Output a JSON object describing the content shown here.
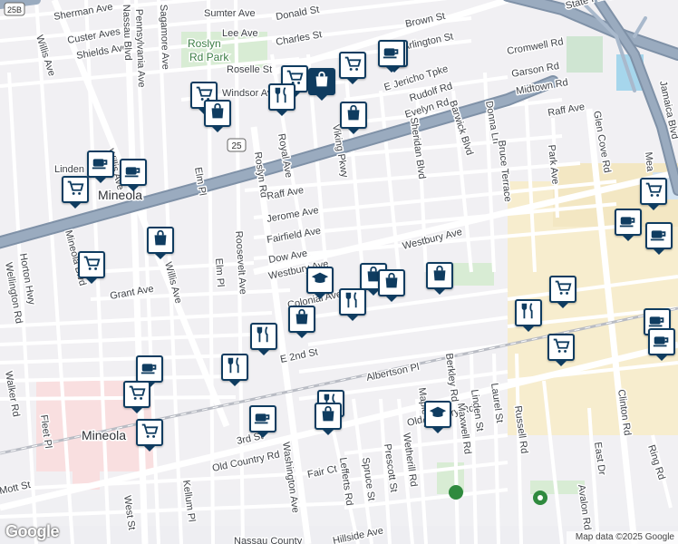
{
  "streets": {
    "sherman_ave": "Sherman Ave",
    "sumter_ave": "Sumter Ave",
    "donald_st": "Donald St",
    "custer_aves": "Custer Aves",
    "lee_ave": "Lee Ave",
    "shields_ave": "Shields Ave",
    "charles_st": "Charles St",
    "brown_st": "Brown St",
    "arlington_st": "Arlington St",
    "roselle_st": "Roselle St",
    "windsor_ave": "Windsor Ave",
    "e_jericho_tpke": "E Jericho Tpke",
    "rudolf_rd": "Rudolf Rd",
    "evelyn_rd": "Evelyn Rd",
    "barwick_blvd": "Barwick Blvd",
    "donna_ln": "Donna Ln",
    "cromwell_rd": "Cromwell Rd",
    "garson_rd": "Garson Rd",
    "midtown_rd": "Midtown Rd",
    "raff_ave_east": "Raff Ave",
    "glen_cove_rd": "Glen Cove Rd",
    "jamaica_blvd": "Jamaica Blvd",
    "state_pkwy": "State Pkwy",
    "willis_ave": "Willis Ave",
    "sagamore_ave": "Sagamore Ave",
    "pennsylvania_ave": "Pennsylvania Ave",
    "nassau_blvd": "Nassau Blvd",
    "linden_pl": "Linden Pl",
    "elm_pl": "Elm Pl",
    "roslyn_rd": "Roslyn Rd",
    "royal_ave": "Royal Ave",
    "sheridan_blvd": "Sheridan Blvd",
    "bruce_terrace": "Bruce Terrace",
    "park_ave": "Park Ave",
    "raff_ave": "Raff Ave",
    "jerome_ave": "Jerome Ave",
    "fairfield_ave": "Fairfield Ave",
    "dow_ave": "Dow Ave",
    "westbury_ave": "Westbury Ave",
    "westbury_ave_w": "Westbury Ave",
    "colonial_ave": "Colonial Ave",
    "horton_hwy": "Horton Hwy",
    "wellington_rd": "Wellington Rd",
    "grant_ave": "Grant Ave",
    "roosevelt_ave": "Roosevelt Ave",
    "mineola_blvd": "Mineola Blvd",
    "walker_rd": "Walker Rd",
    "fleet_pl": "Fleet Pl",
    "e_2nd_st": "E 2nd St",
    "albertson_pl": "Albertson Pl",
    "berkley_rd": "Berkley Rd",
    "old_country_rd": "Old Country Rd",
    "old_country_rd_w": "Old Country Rd",
    "maxwell_rd": "Maxwell Rd",
    "linden_st": "Linden St",
    "laurel_st": "Laurel St",
    "russell_rd": "Russell Rd",
    "clinton_rd": "Clinton Rd",
    "east_dr": "East Dr",
    "ring_rd": "Ring Rd",
    "mott_st": "Mott St",
    "3rd_st": "3rd St",
    "washington_ave": "Washington Ave",
    "fair_ct": "Fair Ct",
    "lefferts_rd": "Lefferts Rd",
    "spruce_st": "Spruce St",
    "prescott_st": "Prescott St",
    "wetherill_rd": "Wetherill Rd",
    "maple_st": "Maple St",
    "west_st": "West St",
    "kellum_pl": "Kellum Pl",
    "avalon_rd": "Avalon Rd",
    "hillside_ave": "Hillside Ave",
    "nassau_county": "Nassau County",
    "viking_pkwy": "Viking Pkwy",
    "meadowbrook": "Mea"
  },
  "places": {
    "roslyn_rd_park": [
      "Roslyn",
      "Rd Park"
    ],
    "mineola_top": "Mineola",
    "mineola_bottom": "Mineola"
  },
  "routes": {
    "r25": "25",
    "r25b": "25B"
  },
  "footer": {
    "google": "Google",
    "map_data": "Map data ©2025 Google"
  },
  "colors": {
    "pin_border": "#0f3c60",
    "highway": "#8a9cb0",
    "background": "#f1f0f3"
  }
}
